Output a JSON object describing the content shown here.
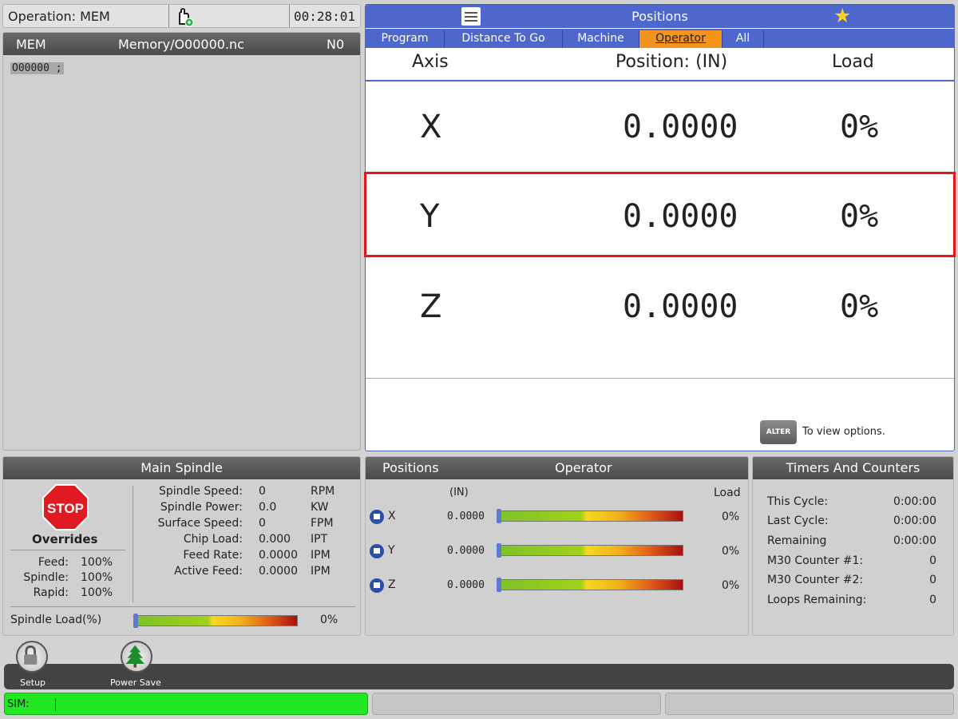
{
  "status": {
    "operation": "Operation: MEM",
    "time": "00:28:01"
  },
  "program": {
    "mode": "MEM",
    "file": "Memory/O00000.nc",
    "n": "N0",
    "line1": "O00000 ;"
  },
  "positions": {
    "title": "Positions",
    "tabs": [
      "Program",
      "Distance To Go",
      "Machine",
      "Operator",
      "All"
    ],
    "active_tab": "Operator",
    "headers": {
      "axis": "Axis",
      "position": "Position:  (IN)",
      "load": "Load"
    },
    "rows": [
      {
        "axis": "X",
        "value": "0.0000",
        "load": "0%"
      },
      {
        "axis": "Y",
        "value": "0.0000",
        "load": "0%"
      },
      {
        "axis": "Z",
        "value": "0.0000",
        "load": "0%"
      }
    ],
    "alter_label": "ALTER",
    "alter_hint": "To view options."
  },
  "spindle": {
    "title": "Main Spindle",
    "stop": "STOP",
    "overrides_title": "Overrides",
    "overrides": [
      {
        "label": "Feed:",
        "value": "100%"
      },
      {
        "label": "Spindle:",
        "value": "100%"
      },
      {
        "label": "Rapid:",
        "value": "100%"
      }
    ],
    "stats": [
      {
        "label": "Spindle Speed:",
        "value": "0",
        "unit": "RPM"
      },
      {
        "label": "Spindle Power:",
        "value": "0.0",
        "unit": "KW"
      },
      {
        "label": "Surface Speed:",
        "value": "0",
        "unit": "FPM"
      },
      {
        "label": "Chip Load:",
        "value": "0.000",
        "unit": "IPT"
      },
      {
        "label": "Feed Rate:",
        "value": "0.0000",
        "unit": "IPM"
      },
      {
        "label": "Active Feed:",
        "value": "0.0000",
        "unit": "IPM"
      }
    ],
    "load_label": "Spindle Load(%)",
    "load_value": "0%",
    "load_fraction": 0
  },
  "pos_small": {
    "title": "Positions",
    "mode": "Operator",
    "unit": "(IN)",
    "load_header": "Load",
    "rows": [
      {
        "axis": "X",
        "value": "0.0000",
        "load": "0%",
        "fraction": 0
      },
      {
        "axis": "Y",
        "value": "0.0000",
        "load": "0%",
        "fraction": 0
      },
      {
        "axis": "Z",
        "value": "0.0000",
        "load": "0%",
        "fraction": 0
      }
    ]
  },
  "timers": {
    "title": "Timers And Counters",
    "rows": [
      {
        "label": "This Cycle:",
        "value": "0:00:00"
      },
      {
        "label": "Last Cycle:",
        "value": "0:00:00"
      },
      {
        "label": "Remaining",
        "value": "0:00:00"
      },
      {
        "label": "M30 Counter #1:",
        "value": "0"
      },
      {
        "label": "M30 Counter #2:",
        "value": "0"
      },
      {
        "label": "Loops Remaining:",
        "value": "0"
      }
    ]
  },
  "dock": {
    "setup": "Setup",
    "power_save": "Power Save"
  },
  "sim": "SIM:",
  "colors": {
    "accent": "#4d67cc",
    "active_tab": "#f4941c",
    "highlight": "#e8141c",
    "sim": "#22e822"
  }
}
